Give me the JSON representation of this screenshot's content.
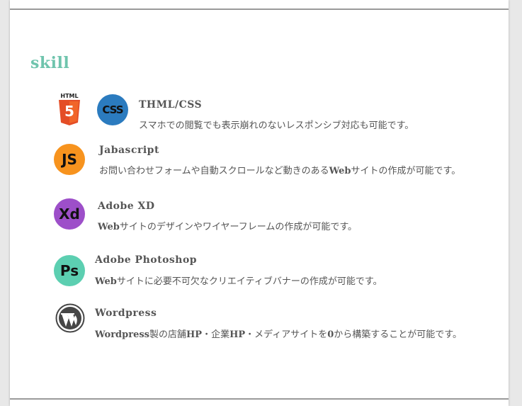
{
  "section": {
    "heading": "skill"
  },
  "skills": [
    {
      "title": "THML/CSS",
      "desc": "スマホでの閲覧でも表示崩れのないレスポンシブ対応も可能です。",
      "icons": [
        "html5-icon",
        "css-icon"
      ],
      "icon_text": {
        "html5_label": "HTML",
        "html5_glyph": "5",
        "css_glyph": "CSS"
      }
    },
    {
      "title": "Jabascript",
      "desc_prefix": "お問い合わせフォームや自動スクロールなど動きのある",
      "desc_bold": "Web",
      "desc_suffix": "サイトの作成が可能です。",
      "icons": [
        "js-icon"
      ],
      "icon_text": {
        "glyph": "JS"
      }
    },
    {
      "title": "Adobe XD",
      "desc_bold": "Web",
      "desc_suffix": "サイトのデザインやワイヤーフレームの作成が可能です。",
      "icons": [
        "adobe-xd-icon"
      ],
      "icon_text": {
        "glyph": "Xd"
      }
    },
    {
      "title": "Adobe Photoshop",
      "desc_bold": "Web",
      "desc_suffix": "サイトに必要不可欠なクリエイティブバナーの作成が可能です。",
      "icons": [
        "photoshop-icon"
      ],
      "icon_text": {
        "glyph": "Ps"
      }
    },
    {
      "title": "Wordpress",
      "desc_bold1": "Wordpress",
      "desc_mid1": "製の店舗",
      "desc_bold2": "HP",
      "desc_mid2": "・企業",
      "desc_bold3": "HP",
      "desc_mid3": "・メディアサイトを",
      "desc_bold4": "0",
      "desc_suffix": "から構築することが可能です。",
      "icons": [
        "wordpress-icon"
      ]
    }
  ],
  "colors": {
    "heading": "#6fc4ad",
    "html5": "#e44d26",
    "css": "#2b7bbf",
    "js": "#f7931e",
    "xd": "#9d4fc9",
    "ps": "#5ccfb1",
    "wordpress": "#464646"
  }
}
